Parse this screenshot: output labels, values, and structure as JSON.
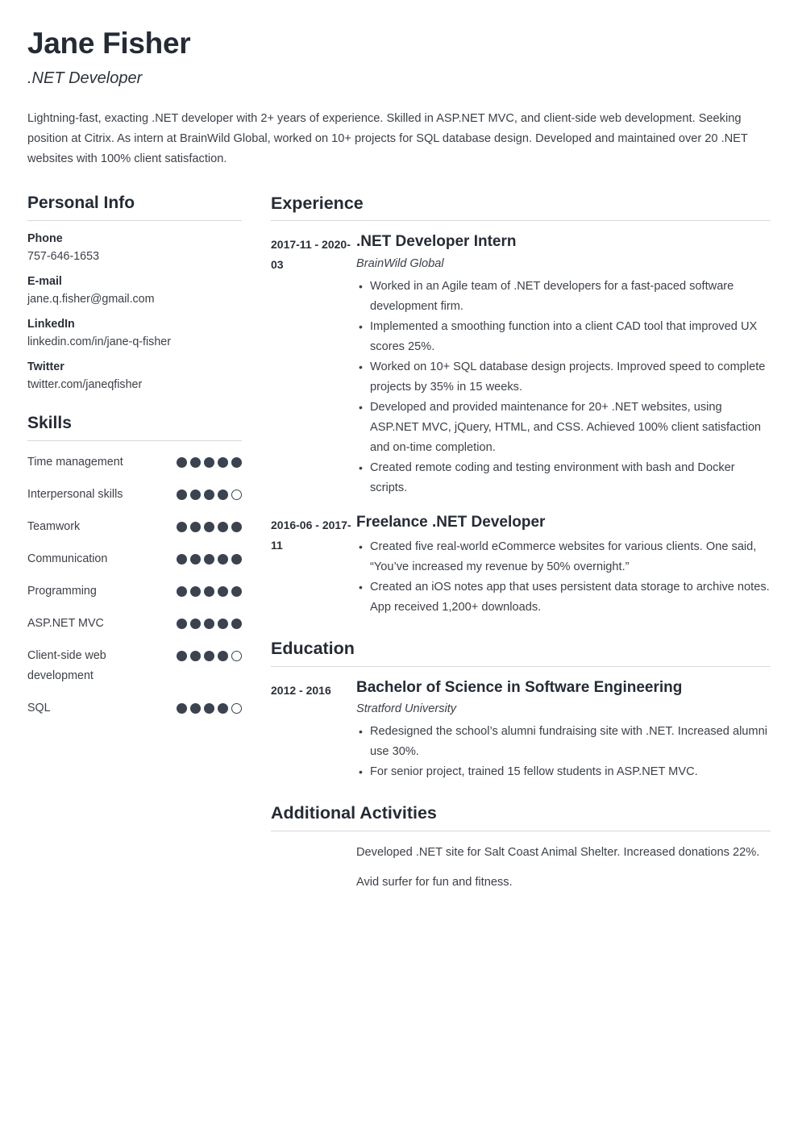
{
  "header": {
    "name": "Jane Fisher",
    "job_title": ".NET Developer",
    "summary": "Lightning-fast, exacting .NET developer with 2+ years of experience. Skilled in ASP.NET MVC, and client-side web development. Seeking position at Citrix. As intern at BrainWild Global, worked on 10+ projects for SQL database design. Developed and maintained over 20 .NET websites with 100% client satisfaction."
  },
  "personal_info": {
    "section_title": "Personal Info",
    "items": [
      {
        "label": "Phone",
        "value": "757-646-1653"
      },
      {
        "label": "E-mail",
        "value": "jane.q.fisher@gmail.com"
      },
      {
        "label": "LinkedIn",
        "value": "linkedin.com/in/jane-q-fisher"
      },
      {
        "label": "Twitter",
        "value": "twitter.com/janeqfisher"
      }
    ]
  },
  "skills": {
    "section_title": "Skills",
    "max_rating": 5,
    "items": [
      {
        "name": "Time management",
        "rating": 5
      },
      {
        "name": "Interpersonal skills",
        "rating": 4
      },
      {
        "name": "Teamwork",
        "rating": 5
      },
      {
        "name": "Communication",
        "rating": 5
      },
      {
        "name": "Programming",
        "rating": 5
      },
      {
        "name": "ASP.NET MVC",
        "rating": 5
      },
      {
        "name": "Client-side web development",
        "rating": 4
      },
      {
        "name": "SQL",
        "rating": 4
      }
    ]
  },
  "experience": {
    "section_title": "Experience",
    "entries": [
      {
        "dates": "2017-11 - 2020-03",
        "title": ".NET Developer Intern",
        "organization": "BrainWild Global",
        "bullets": [
          "Worked in an Agile team of .NET developers for a fast-paced software development firm.",
          "Implemented a smoothing function into a client CAD tool that improved UX scores 25%.",
          "Worked on 10+ SQL database design projects. Improved speed to complete projects by 35% in 15 weeks.",
          "Developed and provided maintenance for 20+ .NET websites, using ASP.NET MVC, jQuery, HTML, and CSS. Achieved 100% client satisfaction and on-time completion.",
          "Created remote coding and testing environment with bash and Docker scripts."
        ]
      },
      {
        "dates": "2016-06 - 2017-11",
        "title": "Freelance .NET Developer",
        "organization": "",
        "bullets": [
          "Created five real-world eCommerce websites for various clients. One said, “You’ve increased my revenue by 50% overnight.”",
          "Created an iOS notes app that uses persistent data storage to archive notes. App received 1,200+ downloads."
        ]
      }
    ]
  },
  "education": {
    "section_title": "Education",
    "entries": [
      {
        "dates": "2012 - 2016",
        "title": "Bachelor of Science in Software Engineering",
        "organization": "Stratford University",
        "bullets": [
          "Redesigned the school’s alumni fundraising site with .NET. Increased alumni use 30%.",
          "For senior project, trained 15 fellow students in ASP.NET MVC."
        ]
      }
    ]
  },
  "additional_activities": {
    "section_title": "Additional Activities",
    "items": [
      "Developed .NET site for Salt Coast Animal Shelter. Increased donations 22%.",
      "Avid surfer for fun and fitness."
    ]
  },
  "colors": {
    "heading": "#252b35",
    "body_text": "#3c4148",
    "rule": "#d8d8d8",
    "dot_filled": "#3b4250",
    "page_background": "#ffffff"
  }
}
